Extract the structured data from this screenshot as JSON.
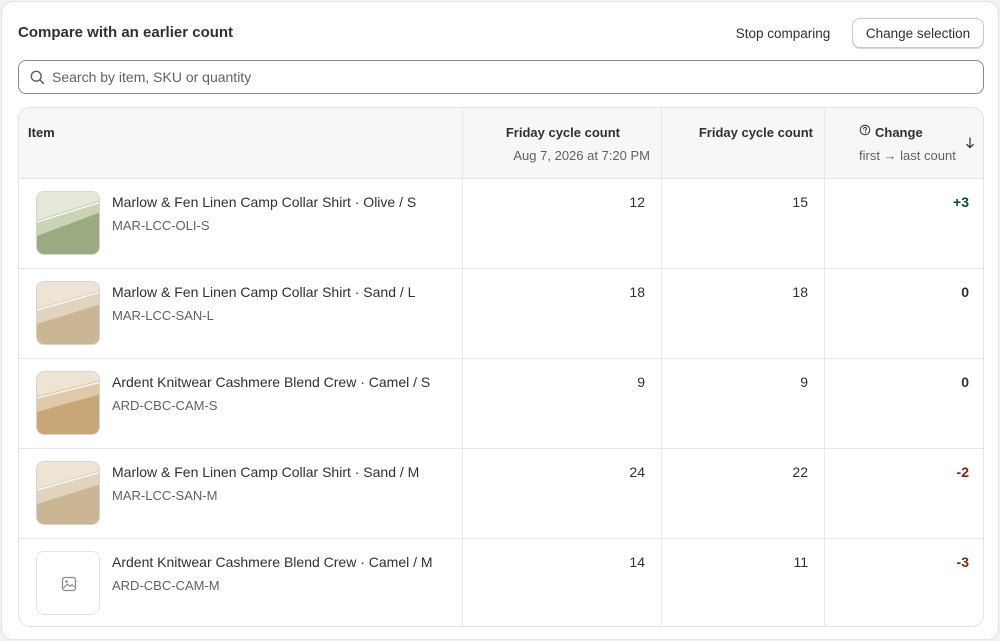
{
  "header": {
    "title": "Compare with an earlier count",
    "stop_label": "Stop comparing",
    "change_label": "Change selection"
  },
  "search": {
    "placeholder": "Search by item, SKU or quantity",
    "value": ""
  },
  "table": {
    "columns": {
      "item": "Item",
      "first": {
        "label": "Friday cycle count",
        "sub": "Aug 7, 2026 at 7:20 PM"
      },
      "last": {
        "label": "Friday cycle count"
      },
      "change": {
        "label": "Change",
        "sub": "first → last count"
      }
    },
    "sort": {
      "column": "change",
      "direction": "descending"
    },
    "rows": [
      {
        "name": "Marlow & Fen Linen Camp Collar Shirt · Olive / S",
        "sku": "MAR-LCC-OLI-S",
        "first": "12",
        "last": "15",
        "change": "+3",
        "thumb": "olive"
      },
      {
        "name": "Marlow & Fen Linen Camp Collar Shirt · Sand / L",
        "sku": "MAR-LCC-SAN-L",
        "first": "18",
        "last": "18",
        "change": "0",
        "thumb": "sand"
      },
      {
        "name": "Ardent Knitwear Cashmere Blend Crew · Camel / S",
        "sku": "ARD-CBC-CAM-S",
        "first": "9",
        "last": "9",
        "change": "0",
        "thumb": "camel"
      },
      {
        "name": "Marlow & Fen Linen Camp Collar Shirt · Sand / M",
        "sku": "MAR-LCC-SAN-M",
        "first": "24",
        "last": "22",
        "change": "-2",
        "thumb": "sand"
      },
      {
        "name": "Ardent Knitwear Cashmere Blend Crew · Camel / M",
        "sku": "ARD-CBC-CAM-M",
        "first": "14",
        "last": "11",
        "change": "-3",
        "thumb": "placeholder-image-icon"
      }
    ]
  },
  "colors": {
    "positive": "#014b40",
    "neutral": "#303030",
    "negative": "#8e1f0b",
    "thumb_olive": [
      "#e3e8d9",
      "#c9d3b6",
      "#9aab82"
    ],
    "thumb_sand": [
      "#eee4d6",
      "#e2d3be",
      "#cbb693"
    ],
    "thumb_camel": [
      "#efe3d3",
      "#e0c9a8",
      "#c9a676"
    ]
  }
}
